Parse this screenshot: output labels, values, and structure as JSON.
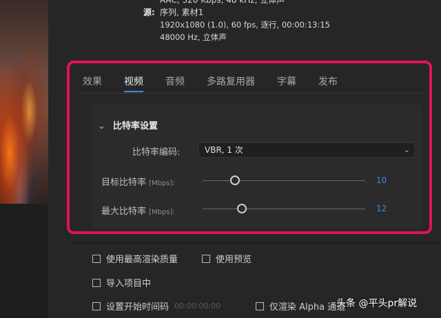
{
  "summary": {
    "audio_line": "AAC, 320 Kbps, 48 kHz, 立体声",
    "source_label": "源:",
    "source_value": "序列, 素材1",
    "video_info": "1920x1080 (1.0), 60 fps, 逐行, 00:00:13:15",
    "audio_info": "48000 Hz, 立体声"
  },
  "tabs": [
    {
      "label": "效果",
      "active": false
    },
    {
      "label": "视频",
      "active": true
    },
    {
      "label": "音频",
      "active": false
    },
    {
      "label": "多路复用器",
      "active": false
    },
    {
      "label": "字幕",
      "active": false
    },
    {
      "label": "发布",
      "active": false
    }
  ],
  "bitrate": {
    "section_title": "比特率设置",
    "encoding_label": "比特率编码:",
    "encoding_value": "VBR, 1 次",
    "target_label": "目标比特率",
    "target_unit": "[Mbps]:",
    "target_value": "10",
    "target_fraction": 0.2,
    "max_label": "最大比特率",
    "max_unit": "[Mbps]:",
    "max_value": "12",
    "max_fraction": 0.24
  },
  "options": {
    "max_quality": "使用最高渲染质量",
    "use_preview": "使用预览",
    "import_project": "导入项目中",
    "set_start_timecode": "设置开始时间码",
    "start_timecode": "00:00:00:00",
    "render_alpha": "仅渲染 Alpha 通道"
  },
  "watermark": "头条 @平头pr解说",
  "colors": {
    "accent": "#3b8ce8",
    "highlight_frame": "#e0115f"
  }
}
